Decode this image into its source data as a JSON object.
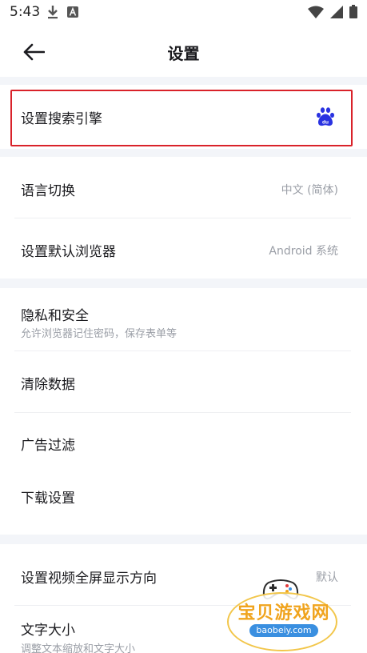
{
  "status_bar": {
    "time": "5:43"
  },
  "header": {
    "title": "设置"
  },
  "sections": [
    {
      "rows": [
        {
          "title": "设置搜索引擎",
          "icon": "baidu-paw-icon"
        }
      ]
    },
    {
      "rows": [
        {
          "title": "语言切换",
          "value": "中文 (简体)"
        },
        {
          "title": "设置默认浏览器",
          "value": "Android 系统"
        }
      ]
    },
    {
      "rows": [
        {
          "title": "隐私和安全",
          "subtitle": "允许浏览器记住密码，保存表单等"
        },
        {
          "title": "清除数据"
        },
        {
          "title": "广告过滤"
        },
        {
          "title": "下载设置"
        }
      ]
    },
    {
      "rows": [
        {
          "title": "设置视频全屏显示方向",
          "value": "默认"
        },
        {
          "title": "文字大小",
          "subtitle": "调整文本缩放和文字大小"
        }
      ]
    }
  ],
  "watermark": {
    "text": "宝贝游戏网",
    "url": "baobeiy.com"
  },
  "colors": {
    "highlight": "#d9222a",
    "baidu_blue": "#2932e1",
    "background": "#f3f5f9"
  }
}
